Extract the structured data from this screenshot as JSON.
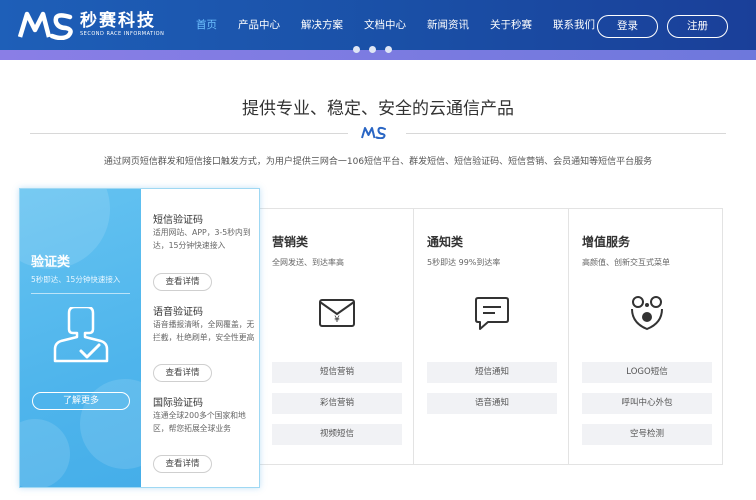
{
  "header": {
    "logo_text": "秒赛科技",
    "logo_subtext": "SECOND RACE INFORMATION",
    "nav": [
      {
        "label": "首页",
        "active": true
      },
      {
        "label": "产品中心"
      },
      {
        "label": "解决方案"
      },
      {
        "label": "文档中心"
      },
      {
        "label": "新闻资讯"
      },
      {
        "label": "关于秒赛"
      },
      {
        "label": "联系我们"
      }
    ],
    "login_label": "登录",
    "register_label": "注册",
    "colors": {
      "bar": "#1a4fa6",
      "active_nav": "#6ec1ff"
    }
  },
  "banner": {
    "indicator_count": 3
  },
  "section": {
    "title": "提供专业、稳定、安全的云通信产品",
    "subtitle": "通过网页短信群发和短信接口触发方式，为用户提供三网合一106短信平台、群发短信、短信验证码、短信营销、会员通知等短信平台服务"
  },
  "featured": {
    "title": "验证类",
    "subtitle": "5秒即达、15分钟快速接入",
    "icon": "verify-icon",
    "more_label": "了解更多",
    "accent": "#4fb5ec",
    "items": [
      {
        "title": "短信验证码",
        "desc": "适用网站、APP，3-5秒内到达，15分钟快速接入",
        "button": "查看详情"
      },
      {
        "title": "语音验证码",
        "desc": "语音播报清晰，全网覆盖，无拦截，杜绝刷单，安全性更高",
        "button": "查看详情"
      },
      {
        "title": "国际验证码",
        "desc": "连通全球200多个国家和地区，帮您拓展全球业务",
        "button": "查看详情"
      }
    ]
  },
  "cards": [
    {
      "title": "营销类",
      "desc": "全网发送、到达率高",
      "icon": "envelope-yen-icon",
      "buttons": [
        "短信营销",
        "彩信营销",
        "视频短信"
      ]
    },
    {
      "title": "通知类",
      "desc": "5秒即达 99%到达率",
      "icon": "chat-bubble-icon",
      "buttons": [
        "短信通知",
        "语音通知"
      ]
    },
    {
      "title": "增值服务",
      "desc": "高颜值、创新交互式菜单",
      "icon": "value-added-icon",
      "buttons": [
        "LOGO短信",
        "呼叫中心外包",
        "空号检测"
      ]
    }
  ]
}
